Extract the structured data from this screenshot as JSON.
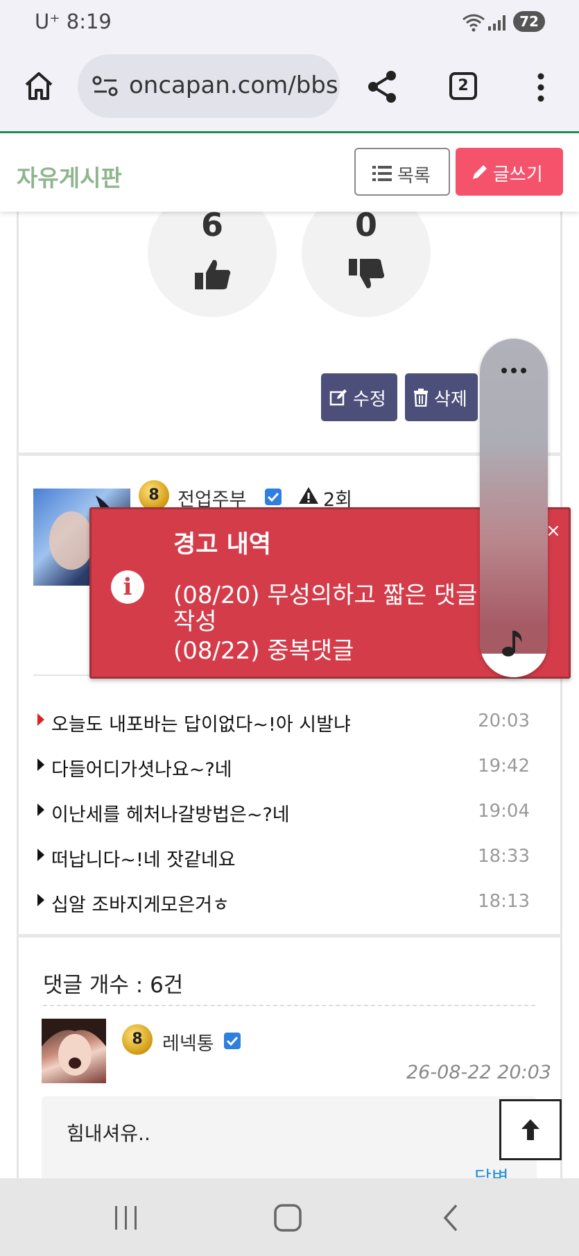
{
  "status_bar": {
    "carrier_time": "U⁺ 8:19",
    "battery": "72"
  },
  "browser": {
    "url": "oncapan.com/bbs",
    "tab_count": "2"
  },
  "board": {
    "title": "자유게시판",
    "list_button": "목록",
    "write_button": "글쓰기"
  },
  "votes": {
    "up": "6",
    "down": "0"
  },
  "post_actions": {
    "edit": "수정",
    "delete": "삭제"
  },
  "author": {
    "name": "전업주부",
    "level": "8",
    "warning_count": "2회"
  },
  "warning_popup": {
    "title": "경고 내역",
    "lines": [
      "(08/20) 무성의하고 짧은 댓글",
      "작성",
      "(08/22) 중복댓글"
    ],
    "close": "×"
  },
  "recent_posts": [
    {
      "title": "오늘도 내포바는 답이없다~!아 시발냐",
      "time": "20:03",
      "marker_color": "#e02020"
    },
    {
      "title": "다들어디가셧나요~?네",
      "time": "19:42",
      "marker_color": "#111111"
    },
    {
      "title": "이난세를 헤처나갈방법은~?네",
      "time": "19:04",
      "marker_color": "#111111"
    },
    {
      "title": "떠납니다~!네 잣같네요",
      "time": "18:33",
      "marker_color": "#111111"
    },
    {
      "title": "십알 조바지게모은거ㅎ",
      "time": "18:13",
      "marker_color": "#111111"
    }
  ],
  "comments": {
    "count_label": "댓글 개수 : 6건",
    "items": [
      {
        "author": "레넥통",
        "level": "8",
        "date": "26-08-22 20:03",
        "text": "힘내셔유..",
        "reply_label": "답변"
      }
    ]
  },
  "colors": {
    "accent_green": "#8fb58f",
    "write_pink": "#f4536b",
    "warning_red": "#d43c4a",
    "dark_button": "#4c4f7a"
  }
}
